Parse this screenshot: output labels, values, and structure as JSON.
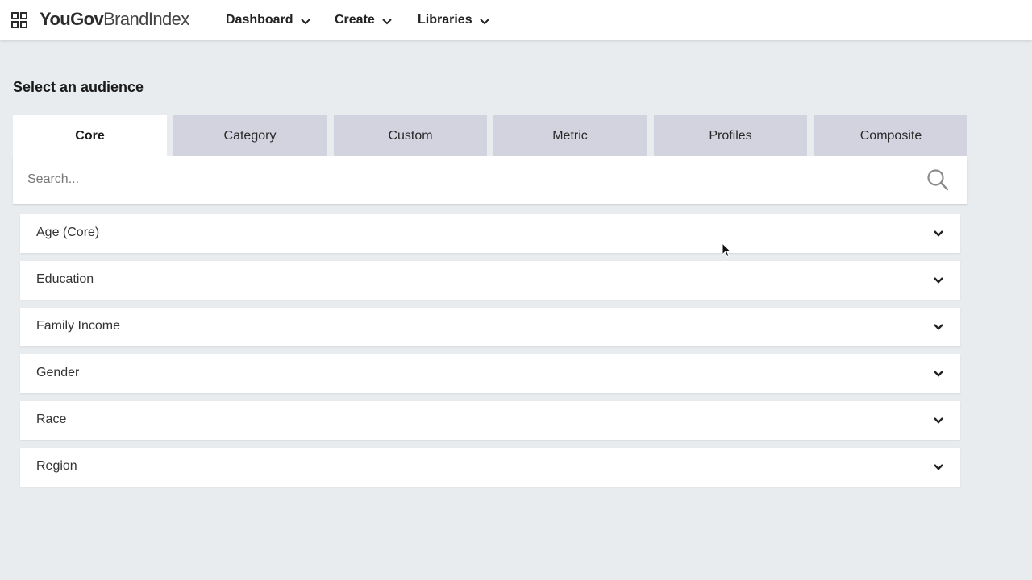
{
  "header": {
    "brand_bold": "YouGov",
    "brand_light": "BrandIndex",
    "apps_icon": "grid-apps-icon",
    "nav": [
      {
        "label": "Dashboard",
        "icon": "chevron-down-icon"
      },
      {
        "label": "Create",
        "icon": "chevron-down-icon"
      },
      {
        "label": "Libraries",
        "icon": "chevron-down-icon"
      }
    ]
  },
  "main": {
    "title": "Select an audience",
    "tabs": [
      {
        "label": "Core",
        "active": true
      },
      {
        "label": "Category",
        "active": false
      },
      {
        "label": "Custom",
        "active": false
      },
      {
        "label": "Metric",
        "active": false
      },
      {
        "label": "Profiles",
        "active": false
      },
      {
        "label": "Composite",
        "active": false
      }
    ],
    "search": {
      "placeholder": "Search...",
      "value": "",
      "icon": "search-icon"
    },
    "groups": [
      {
        "label": "Age (Core)",
        "icon": "chevron-down-icon"
      },
      {
        "label": "Education",
        "icon": "chevron-down-icon"
      },
      {
        "label": "Family Income",
        "icon": "chevron-down-icon"
      },
      {
        "label": "Gender",
        "icon": "chevron-down-icon"
      },
      {
        "label": "Race",
        "icon": "chevron-down-icon"
      },
      {
        "label": "Region",
        "icon": "chevron-down-icon"
      }
    ]
  },
  "colors": {
    "page_background": "#e8ecee",
    "tab_inactive": "#d3d3e0",
    "tab_active": "#ffffff",
    "text_primary": "#222222"
  }
}
